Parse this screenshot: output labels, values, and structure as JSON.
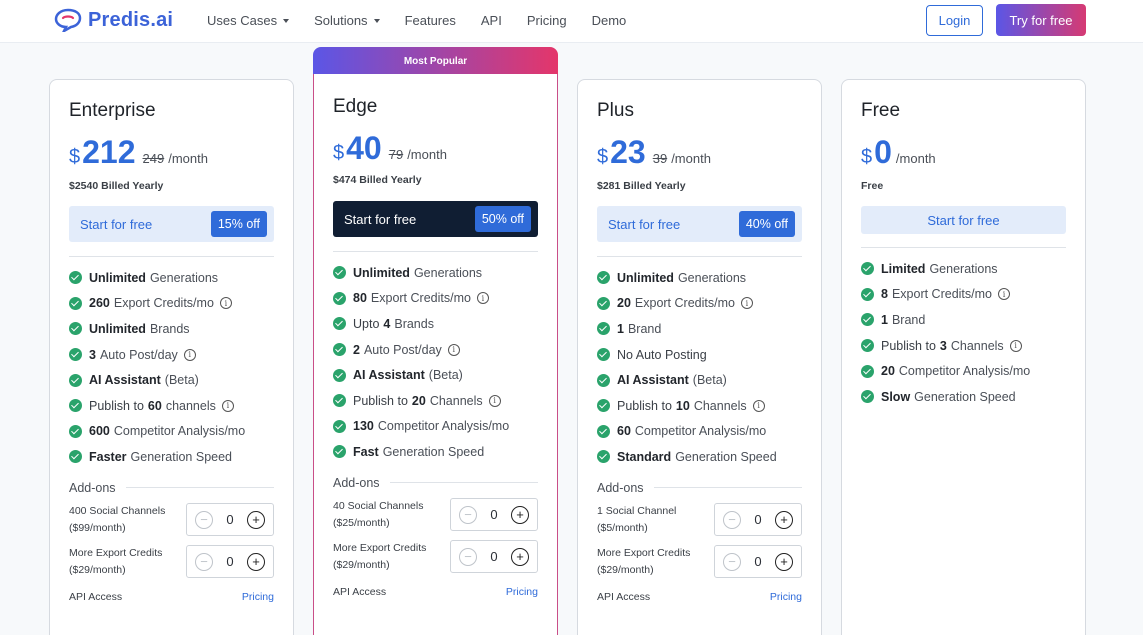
{
  "nav": {
    "brand": "Predis.ai",
    "links": [
      {
        "label": "Uses Cases",
        "dropdown": true
      },
      {
        "label": "Solutions",
        "dropdown": true
      },
      {
        "label": "Features",
        "dropdown": false
      },
      {
        "label": "API",
        "dropdown": false
      },
      {
        "label": "Pricing",
        "dropdown": false
      },
      {
        "label": "Demo",
        "dropdown": false
      }
    ],
    "login_label": "Login",
    "try_label": "Try for free"
  },
  "colors": {
    "accent": "#2f6bd9",
    "check": "#2aa36b",
    "gradient_start": "#5b56e6",
    "gradient_end": "#e4366a"
  },
  "popular_badge": "Most Popular",
  "addons_title": "Add-ons",
  "api_access_label": "API Access",
  "pricing_link": "Pricing",
  "plans": [
    {
      "name": "Enterprise",
      "currency": "$",
      "price": "212",
      "old_price": "249",
      "per": "/month",
      "billed": "$2540 Billed Yearly",
      "cta": "Start for free",
      "discount": "15% off",
      "features": [
        {
          "bold": "Unlimited",
          "text": "Generations",
          "info": false
        },
        {
          "bold": "260",
          "text": "Export Credits/mo",
          "info": true
        },
        {
          "bold": "Unlimited",
          "text": "Brands",
          "info": false
        },
        {
          "bold": "3",
          "text": "Auto Post/day",
          "info": true
        },
        {
          "bold": "AI Assistant",
          "text": "(Beta)",
          "info": false
        },
        {
          "pre": "Publish to",
          "bold": "60",
          "text": "channels",
          "info": true
        },
        {
          "bold": "600",
          "text": "Competitor Analysis/mo",
          "info": false
        },
        {
          "bold": "Faster",
          "text": "Generation Speed",
          "info": false
        }
      ],
      "addons": [
        {
          "label": "400 Social Channels",
          "price": "($99/month)",
          "value": "0"
        },
        {
          "label": "More Export Credits",
          "price": "($29/month)",
          "value": "0"
        }
      ]
    },
    {
      "name": "Edge",
      "currency": "$",
      "price": "40",
      "old_price": "79",
      "per": "/month",
      "billed": "$474 Billed Yearly",
      "cta": "Start for free",
      "discount": "50% off",
      "features": [
        {
          "bold": "Unlimited",
          "text": "Generations",
          "info": false
        },
        {
          "bold": "80",
          "text": "Export Credits/mo",
          "info": true
        },
        {
          "pre": "Upto",
          "bold": "4",
          "text": "Brands",
          "info": false
        },
        {
          "bold": "2",
          "text": "Auto Post/day",
          "info": true
        },
        {
          "bold": "AI Assistant",
          "text": "(Beta)",
          "info": false
        },
        {
          "pre": "Publish to",
          "bold": "20",
          "text": "Channels",
          "info": true
        },
        {
          "bold": "130",
          "text": "Competitor Analysis/mo",
          "info": false
        },
        {
          "bold": "Fast",
          "text": "Generation Speed",
          "info": false
        }
      ],
      "addons": [
        {
          "label": "40 Social Channels",
          "price": "($25/month)",
          "value": "0"
        },
        {
          "label": "More Export Credits",
          "price": "($29/month)",
          "value": "0"
        }
      ]
    },
    {
      "name": "Plus",
      "currency": "$",
      "price": "23",
      "old_price": "39",
      "per": "/month",
      "billed": "$281 Billed Yearly",
      "cta": "Start for free",
      "discount": "40% off",
      "features": [
        {
          "bold": "Unlimited",
          "text": "Generations",
          "info": false
        },
        {
          "bold": "20",
          "text": "Export Credits/mo",
          "info": true
        },
        {
          "bold": "1",
          "text": "Brand",
          "info": false
        },
        {
          "pre": "No Auto Posting",
          "info": false
        },
        {
          "bold": "AI Assistant",
          "text": "(Beta)",
          "info": false
        },
        {
          "pre": "Publish to",
          "bold": "10",
          "text": "Channels",
          "info": true
        },
        {
          "bold": "60",
          "text": "Competitor Analysis/mo",
          "info": false
        },
        {
          "bold": "Standard",
          "text": "Generation Speed",
          "info": false
        }
      ],
      "addons": [
        {
          "label": "1 Social Channel",
          "price": "($5/month)",
          "value": "0"
        },
        {
          "label": "More Export Credits",
          "price": "($29/month)",
          "value": "0"
        }
      ]
    },
    {
      "name": "Free",
      "currency": "$",
      "price": "0",
      "per": "/month",
      "billed": "Free",
      "cta": "Start for free",
      "features": [
        {
          "bold": "Limited",
          "text": "Generations",
          "info": false
        },
        {
          "bold": "8",
          "text": "Export Credits/mo",
          "info": true
        },
        {
          "bold": "1",
          "text": "Brand",
          "info": false
        },
        {
          "pre": "Publish to",
          "bold": "3",
          "text": "Channels",
          "info": true
        },
        {
          "bold": "20",
          "text": "Competitor Analysis/mo",
          "info": false
        },
        {
          "bold": "Slow",
          "text": "Generation Speed",
          "info": false
        }
      ]
    }
  ]
}
